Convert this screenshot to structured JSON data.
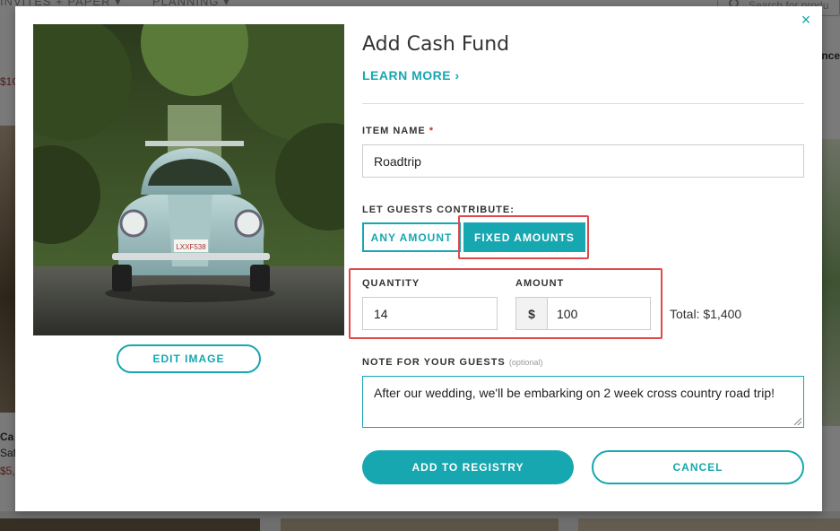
{
  "background": {
    "nav": [
      "INVITES + PAPER ▾",
      "PLANNING ▾"
    ],
    "search_placeholder": "Search for produ",
    "left_texts": [
      "Ca",
      "Saf",
      "$5,"
    ],
    "left_price_top": "$1C",
    "right_text": "nce"
  },
  "modal": {
    "close_label": "×",
    "title": "Add Cash Fund",
    "learn_more": "LEARN MORE ›",
    "edit_image_label": "EDIT IMAGE",
    "plate_text": "LXXF538",
    "item_name": {
      "label": "ITEM NAME",
      "required_mark": "*",
      "value": "Roadtrip"
    },
    "contribute": {
      "label": "LET GUESTS CONTRIBUTE:",
      "options": [
        "ANY AMOUNT",
        "FIXED AMOUNTS"
      ],
      "selected": "FIXED AMOUNTS"
    },
    "quantity": {
      "label": "QUANTITY",
      "value": "14"
    },
    "amount": {
      "label": "AMOUNT",
      "currency": "$",
      "value": "100"
    },
    "total": "Total: $1,400",
    "note": {
      "label": "NOTE FOR YOUR GUESTS",
      "optional": "(optional)",
      "value": "After our wedding, we'll be embarking on 2 week cross country road trip!"
    },
    "add_label": "ADD TO REGISTRY",
    "cancel_label": "CANCEL"
  },
  "colors": {
    "accent": "#16a7b0",
    "highlight": "#e0484a",
    "required": "#c0392b"
  }
}
